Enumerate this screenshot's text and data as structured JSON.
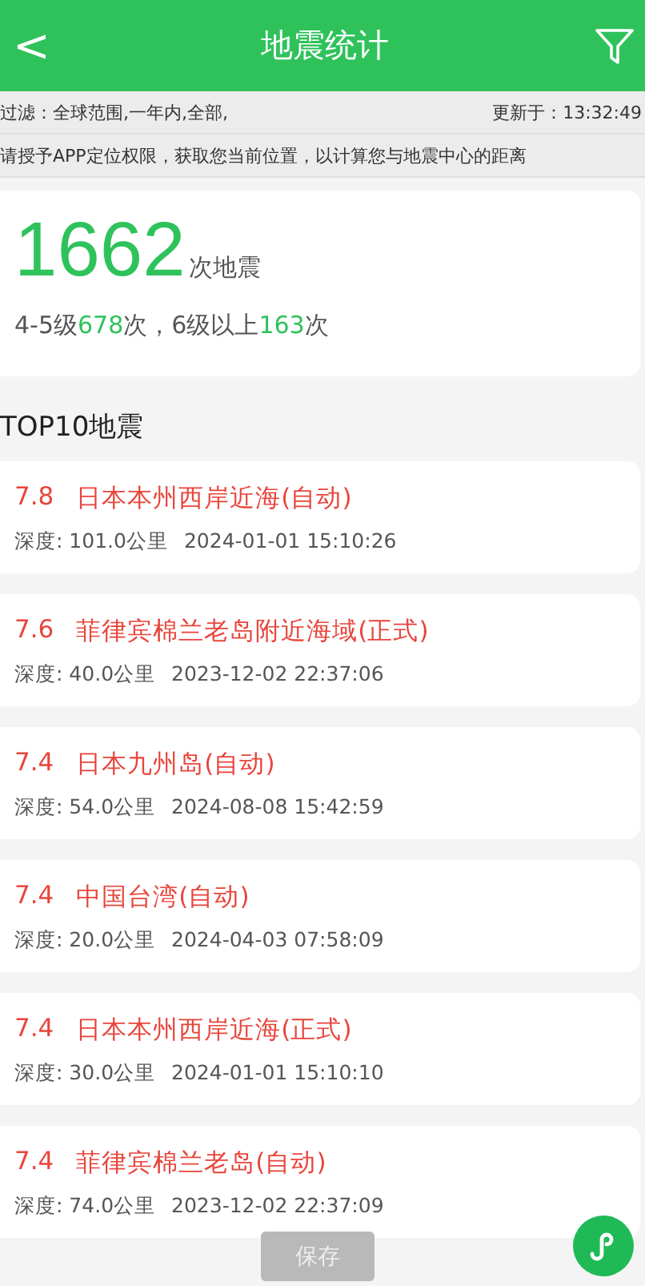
{
  "header": {
    "back": "<",
    "title": "地震统计"
  },
  "filter_bar": {
    "filter": "过滤：全球范围,一年内,全部,",
    "updated": "更新于：13:32:49"
  },
  "notice": "请授予APP定位权限，获取您当前位置，以计算您与地震中心的距离",
  "summary": {
    "total": "1662",
    "total_unit": "次地震",
    "breakdown": [
      {
        "kind": "text",
        "text": "4-5级"
      },
      {
        "kind": "num",
        "text": "678"
      },
      {
        "kind": "text",
        "text": "次，6级以上"
      },
      {
        "kind": "num",
        "text": "163"
      },
      {
        "kind": "text",
        "text": "次"
      }
    ]
  },
  "section_title": "TOP10地震",
  "quakes": [
    {
      "magnitude": "7.8",
      "place": "日本本州西岸近海(自动)",
      "depth": "深度: 101.0公里",
      "time": "2024-01-01 15:10:26"
    },
    {
      "magnitude": "7.6",
      "place": "菲律宾棉兰老岛附近海域(正式)",
      "depth": "深度: 40.0公里",
      "time": "2023-12-02 22:37:06"
    },
    {
      "magnitude": "7.4",
      "place": "日本九州岛(自动)",
      "depth": "深度: 54.0公里",
      "time": "2024-08-08 15:42:59"
    },
    {
      "magnitude": "7.4",
      "place": "中国台湾(自动)",
      "depth": "深度: 20.0公里",
      "time": "2024-04-03 07:58:09"
    },
    {
      "magnitude": "7.4",
      "place": "日本本州西岸近海(正式)",
      "depth": "深度: 30.0公里",
      "time": "2024-01-01 15:10:10"
    },
    {
      "magnitude": "7.4",
      "place": "菲律宾棉兰老岛(自动)",
      "depth": "深度: 74.0公里",
      "time": "2023-12-02 22:37:09"
    }
  ],
  "save_button": "保存"
}
